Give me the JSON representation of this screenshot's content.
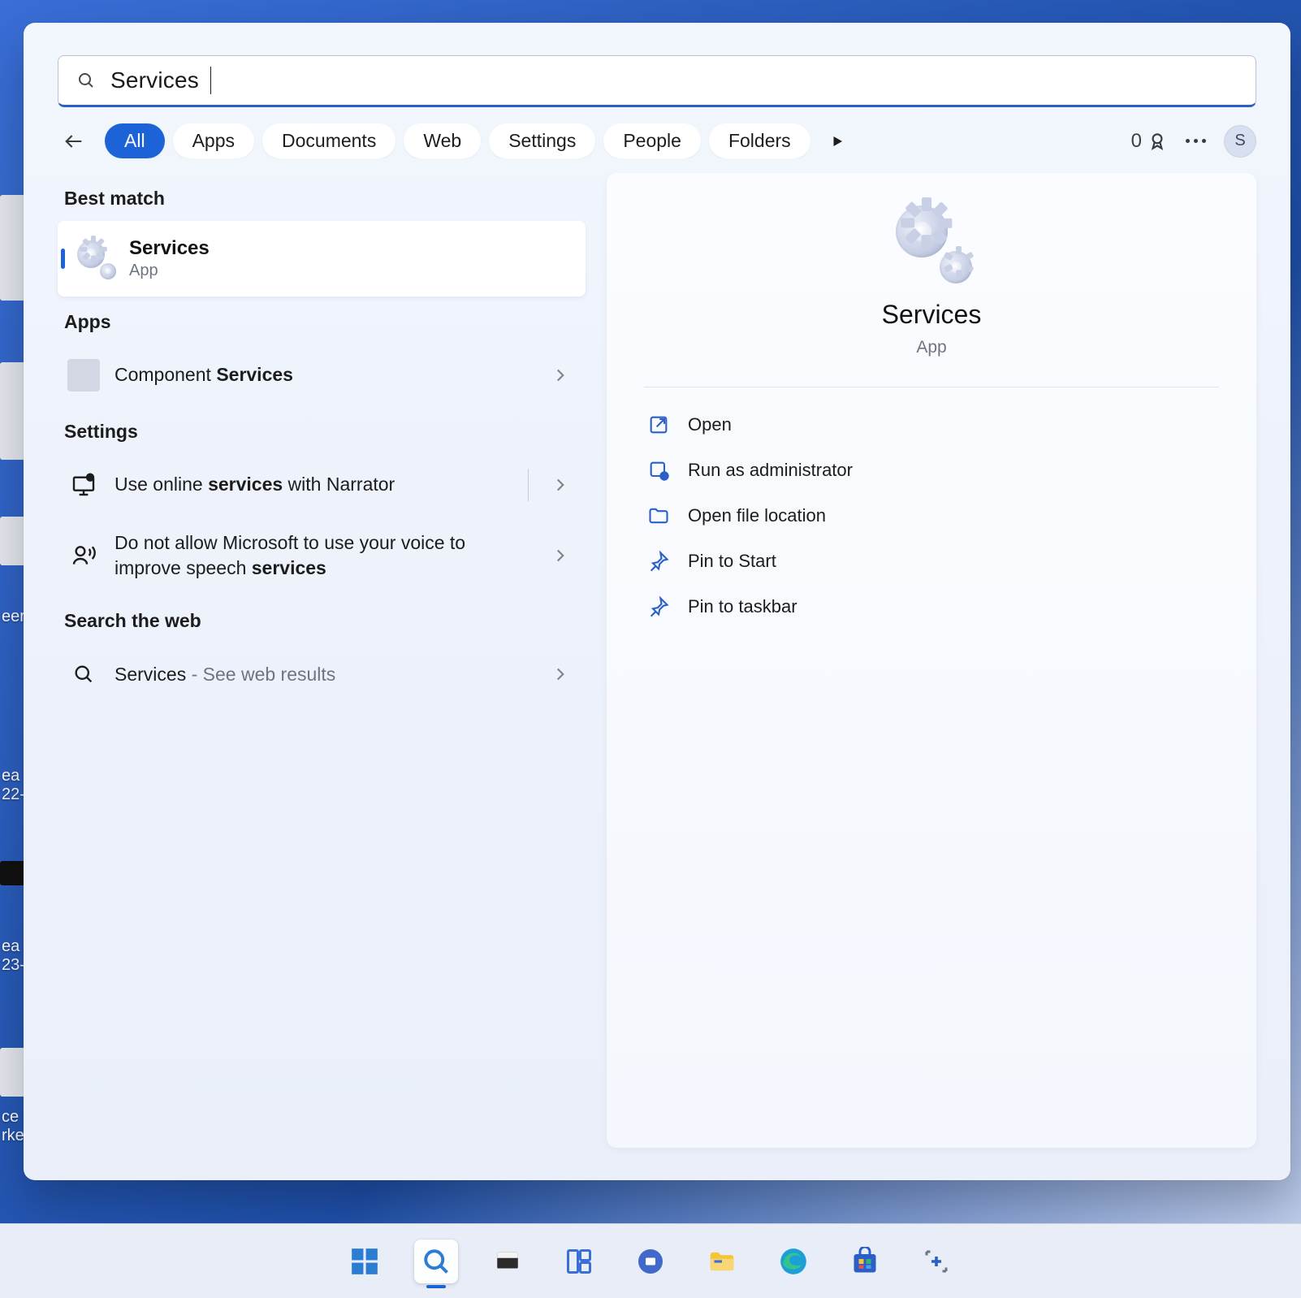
{
  "search": {
    "value": "Services"
  },
  "tabs": [
    "All",
    "Apps",
    "Documents",
    "Web",
    "Settings",
    "People",
    "Folders"
  ],
  "activeTab": 0,
  "points": "0",
  "avatar": "S",
  "headings": {
    "best_match": "Best match",
    "apps": "Apps",
    "settings": "Settings",
    "web": "Search the web"
  },
  "bestMatch": {
    "title": "Services",
    "subtitle": "App"
  },
  "appsList": [
    {
      "prefix": "Component ",
      "keyword": "Services",
      "suffix": ""
    }
  ],
  "settingsList": [
    {
      "prefix": "Use online ",
      "keyword": "services",
      "suffix": " with Narrator"
    },
    {
      "prefix": "Do not allow Microsoft to use your voice to improve speech ",
      "keyword": "services",
      "suffix": ""
    }
  ],
  "webList": [
    {
      "title": "Services",
      "hint": " - See web results"
    }
  ],
  "preview": {
    "title": "Services",
    "subtitle": "App"
  },
  "actions": [
    {
      "icon": "open",
      "label": "Open"
    },
    {
      "icon": "admin",
      "label": "Run as administrator"
    },
    {
      "icon": "folder",
      "label": "Open file location"
    },
    {
      "icon": "pin",
      "label": "Pin to Start"
    },
    {
      "icon": "pin",
      "label": "Pin to taskbar"
    }
  ],
  "bg_labels": [
    "eer",
    "eer",
    "ea\n22-",
    "ea\n23-",
    "ce\nrke"
  ]
}
